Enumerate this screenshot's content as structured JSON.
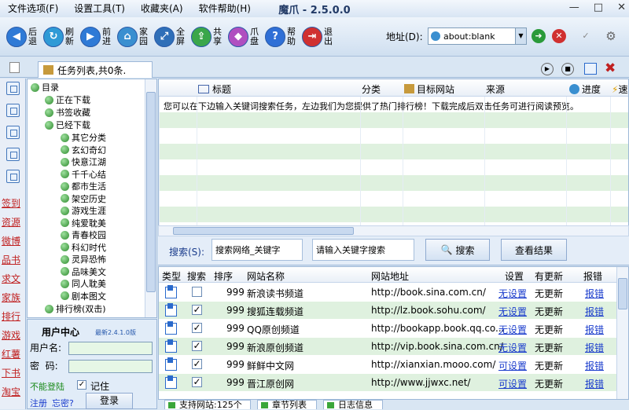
{
  "menu": [
    "文件选项(F)",
    "设置工具(T)",
    "收藏夹(A)",
    "软件帮助(H)"
  ],
  "app_title": "魔爪 - 2.5.0.0",
  "window_buttons": [
    "—",
    "□",
    "✕"
  ],
  "toolbar": [
    {
      "label": "后退",
      "icon": "back-icon",
      "color": "#2f7ad6"
    },
    {
      "label": "刷新",
      "icon": "refresh-icon",
      "color": "#2f9ad6"
    },
    {
      "label": "前进",
      "icon": "forward-icon",
      "color": "#2f7ad6"
    },
    {
      "label": "家园",
      "icon": "home-icon",
      "color": "#3a8fd0"
    },
    {
      "label": "全屏",
      "icon": "fullscreen-icon",
      "color": "#2f6fb8"
    },
    {
      "label": "共享",
      "icon": "share-icon",
      "color": "#3aa64a"
    },
    {
      "label": "爪盘",
      "icon": "claw-disk-icon",
      "color": "#b04fc0"
    },
    {
      "label": "帮助",
      "icon": "help-icon",
      "color": "#2f6fd6"
    },
    {
      "label": "退出",
      "icon": "exit-icon",
      "color": "#d03030"
    }
  ],
  "address": {
    "label": "地址(D):",
    "value": "about:blank"
  },
  "task_tab": "任务列表,共0条.",
  "left_nav": [
    "签到",
    "资源",
    "微博",
    "品书",
    "求文",
    "家族",
    "排行",
    "游戏",
    "红薯",
    "下书",
    "淘宝"
  ],
  "tree": {
    "root": "目录",
    "top": [
      "正在下载",
      "书签收藏",
      "已经下载"
    ],
    "categories": [
      "其它分类",
      "玄幻奇幻",
      "快意江湖",
      "千千心结",
      "都市生活",
      "架空历史",
      "游戏生涯",
      "纯爱耽美",
      "青春校园",
      "科幻时代",
      "灵异恐怖",
      "品味美文",
      "同人耽美",
      "剧本图文"
    ],
    "last": "排行榜(双击)"
  },
  "user_center": {
    "title": "用户中心",
    "version": "最新2.4.1.0版",
    "username_label": "用户名:",
    "password_label": "密  码:",
    "cannot_login": "不能登陆",
    "remember": "记住",
    "register": "注册",
    "forgot": "忘密?",
    "login": "登录"
  },
  "task_grid": {
    "columns": [
      "标题",
      "分类",
      "目标网站",
      "来源",
      "进度",
      "速度"
    ],
    "hint": "您可以在下边输入关键词搜索任务，左边我们为您提供了热门排行榜！下载完成后双击任务可进行阅读预览。"
  },
  "search": {
    "label": "搜索(S):",
    "site_select": "搜索网络_关键字",
    "placeholder": "请输入关键字搜索",
    "search_button": "搜索",
    "results_button": "查看结果"
  },
  "site_table": {
    "columns": [
      "类型",
      "搜索",
      "排序",
      "网站名称",
      "网站地址",
      "设置",
      "有更新",
      "报错"
    ],
    "rows": [
      {
        "checked": false,
        "order": "999",
        "name": "新浪读书频道",
        "url": "http://book.sina.com.cn/",
        "setting": "无设置",
        "update": "无更新",
        "report": "报错"
      },
      {
        "checked": true,
        "order": "999",
        "name": "搜狐连载频道",
        "url": "http://lz.book.sohu.com/",
        "setting": "无设置",
        "update": "无更新",
        "report": "报错"
      },
      {
        "checked": true,
        "order": "999",
        "name": "QQ原创频道",
        "url": "http://bookapp.book.qq.co...",
        "setting": "无设置",
        "update": "无更新",
        "report": "报错"
      },
      {
        "checked": true,
        "order": "999",
        "name": "新浪原创频道",
        "url": "http://vip.book.sina.com.cn/",
        "setting": "无设置",
        "update": "无更新",
        "report": "报错"
      },
      {
        "checked": true,
        "order": "999",
        "name": "鲜鲜中文网",
        "url": "http://xianxian.mooo.com/",
        "setting": "可设置",
        "update": "无更新",
        "report": "报错"
      },
      {
        "checked": true,
        "order": "999",
        "name": "晋江原创网",
        "url": "http://www.jjwxc.net/",
        "setting": "可设置",
        "update": "无更新",
        "report": "报错"
      }
    ]
  },
  "bottom_tabs": [
    "支持网站:125个",
    "章节列表",
    "日志信息"
  ]
}
